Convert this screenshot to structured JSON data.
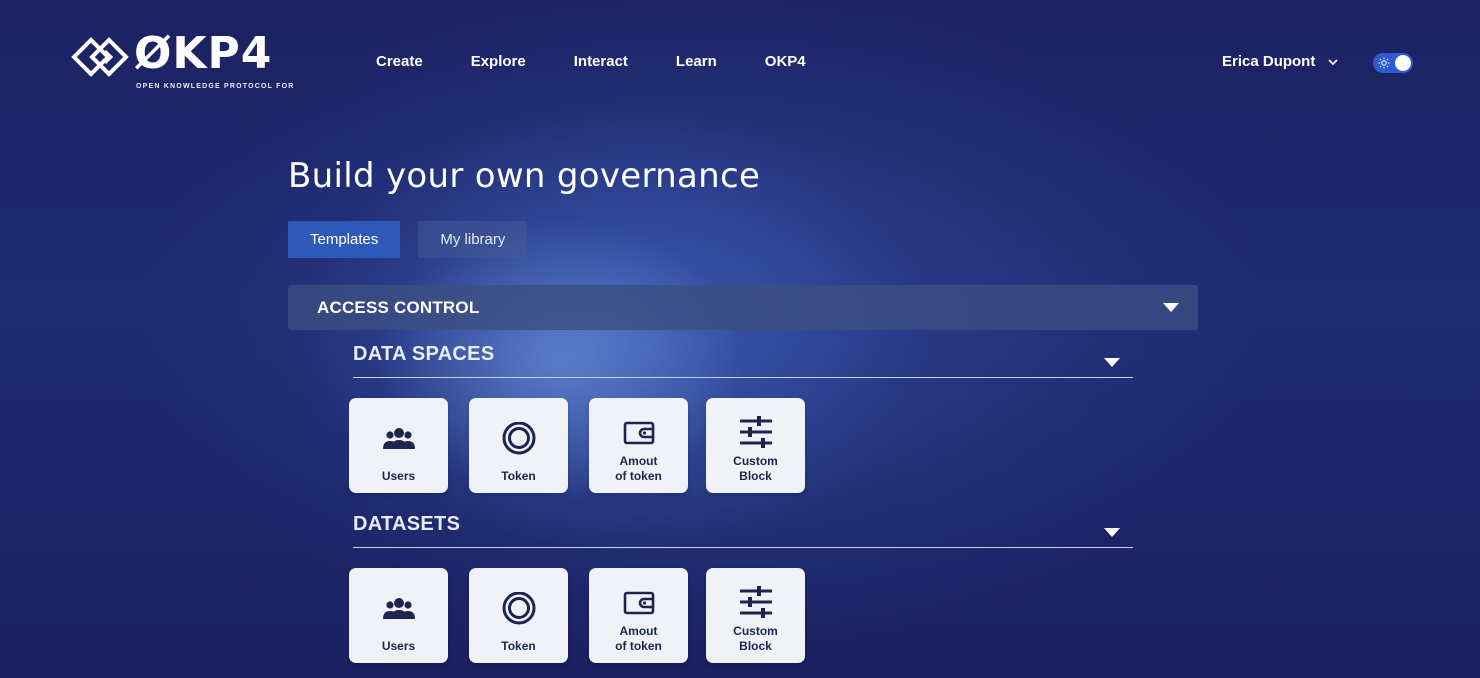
{
  "brand": {
    "name": "ØKP4",
    "tagline": "OPEN KNOWLEDGE PROTOCOL FOR"
  },
  "nav": {
    "items": [
      {
        "label": "Create"
      },
      {
        "label": "Explore"
      },
      {
        "label": "Interact"
      },
      {
        "label": "Learn"
      },
      {
        "label": "OKP4"
      }
    ]
  },
  "user": {
    "name": "Erica Dupont",
    "theme_toggle": "light-mode-toggle"
  },
  "page": {
    "title": "Build your own governance"
  },
  "tabs": [
    {
      "label": "Templates",
      "active": true
    },
    {
      "label": "My library",
      "active": false
    }
  ],
  "accordion": {
    "label": "ACCESS CONTROL"
  },
  "sections": [
    {
      "label": "DATA SPACES",
      "cards": [
        {
          "label": "Users",
          "icon": "users-icon"
        },
        {
          "label": "Token",
          "icon": "token-icon"
        },
        {
          "label": "Amout\nof token",
          "icon": "wallet-icon"
        },
        {
          "label": "Custom\nBlock",
          "icon": "sliders-icon"
        }
      ]
    },
    {
      "label": "DATASETS",
      "cards": [
        {
          "label": "Users",
          "icon": "users-icon"
        },
        {
          "label": "Token",
          "icon": "token-icon"
        },
        {
          "label": "Amout\nof token",
          "icon": "wallet-icon"
        },
        {
          "label": "Custom\nBlock",
          "icon": "sliders-icon"
        }
      ]
    }
  ],
  "colors": {
    "background": "#1b2160",
    "accent": "#2f59b8",
    "card": "#f1f2f7",
    "card_text": "#1d2450"
  }
}
